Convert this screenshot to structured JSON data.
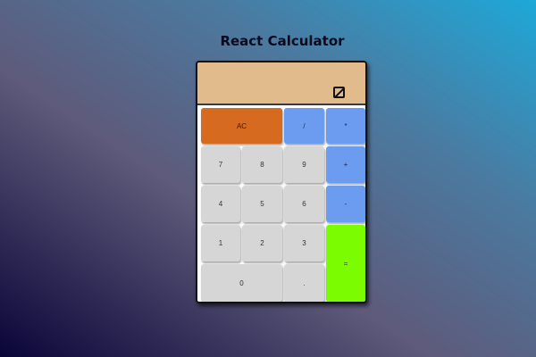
{
  "title": "React Calculator",
  "display": {
    "value": ""
  },
  "keys": {
    "ac": "AC",
    "divide": "/",
    "multiply": "*",
    "seven": "7",
    "eight": "8",
    "nine": "9",
    "plus": "+",
    "four": "4",
    "five": "5",
    "six": "6",
    "minus": "-",
    "one": "1",
    "two": "2",
    "three": "3",
    "equals": "=",
    "zero": "0",
    "dot": "."
  },
  "colors": {
    "display_bg": "#e1bb8c",
    "ac_bg": "#d66a1f",
    "operator_bg": "#6b9cf0",
    "equals_bg": "#7cfc00",
    "number_bg": "#d6d6d6"
  }
}
